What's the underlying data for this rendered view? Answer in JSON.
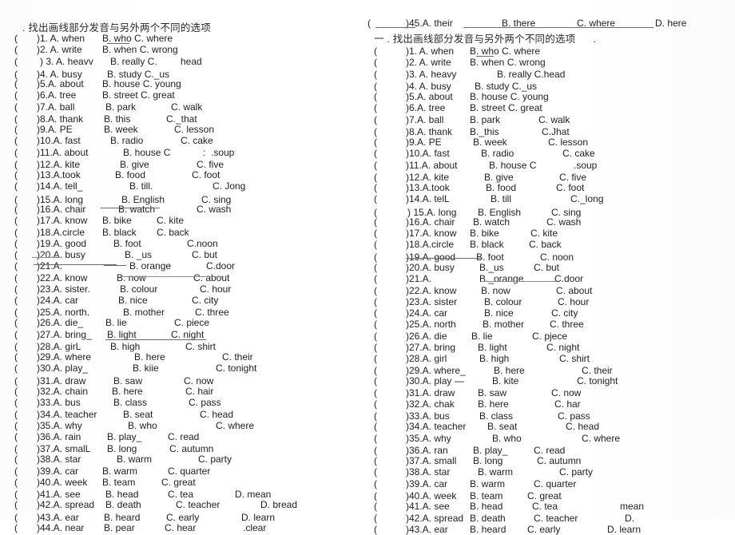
{
  "document": {
    "type": "scanned-worksheet",
    "background_color": "#ffffff",
    "text_color": "#1e1e1e",
    "rule_color": "#6b6b6b"
  },
  "left_column": {
    "heading": ". 找出画线部分发音与另外两个不同的选项",
    "bracket_open": "(",
    "rows": [
      {
        "num": ")1. A. when",
        "b": "B. who C. where"
      },
      {
        "num": ")2. A. write",
        "b": "B. when C. wrong"
      },
      {
        "num": ") 3. A. heavv",
        "b": "B. really C.",
        "c": "head"
      },
      {
        "num": ")4. A. busy",
        "b": "B. study C._us"
      },
      {
        "num": ")5.A. about",
        "b": "B. house C. young"
      },
      {
        "num": ")6.A. tree",
        "b": "B. street C. great"
      },
      {
        "num": ")7.A. ball",
        "b": "B. park",
        "c": "C. walk"
      },
      {
        "num": ")8.A. thank",
        "b": "B. this",
        "c": "C._that"
      },
      {
        "num": ")9.A. PE",
        "b": "B. week",
        "c": "C. lesson"
      },
      {
        "num": ")10.A. fast",
        "b": "B. radio",
        "c": "C. cake"
      },
      {
        "num": ")11.A. about",
        "b": "B. house C",
        "c": ":  .soup"
      },
      {
        "num": ")12.A. kite",
        "b": "B. give",
        "c": "C. five"
      },
      {
        "num": ")13.A.took",
        "b": "B. food",
        "c": "C. foot"
      },
      {
        "num": ")14.A. tell_",
        "b": "B. till.",
        "c": "C. Jong"
      },
      {
        "num": ")15.A. long",
        "b": "B. English",
        "c": "C. sing"
      },
      {
        "num": ")16.A. chair",
        "b": "B. watch",
        "c": "C. wash"
      },
      {
        "num": ")17.A. know",
        "b": "B. bike",
        "c": "C. kite"
      },
      {
        "num": ")18.A.circle",
        "b": "B. black",
        "c": "C. back"
      },
      {
        "num": ")19.A. good",
        "b": "B. foot",
        "c": "C.noon"
      },
      {
        "num": ")20.A. busy",
        "b": "B. _us",
        "c": "C. but"
      },
      {
        "num": ")21.A.",
        "b": "B. orange",
        "c": "C.door"
      },
      {
        "num": ")22.A. know",
        "b": "B. now",
        "c": "C. about"
      },
      {
        "num": ")23.A. sister.",
        "b": "B. colour",
        "c": "C. hour"
      },
      {
        "num": ")24.A. car",
        "b": "B. nice",
        "c": "C. city"
      },
      {
        "num": ")25.A. north.",
        "b": "B. mother",
        "c": "C. three"
      },
      {
        "num": ")26.A. die_",
        "b": "B. lie",
        "c": "C. piece"
      },
      {
        "num": ")27.A. bring_",
        "b": "B. light",
        "c": "C. night"
      },
      {
        "num": ")28.A. girL",
        "b": "B. high",
        "c": "C. shirt"
      },
      {
        "num": ")29.A. where",
        "b": "B. here",
        "c": "C. their"
      },
      {
        "num": ")30.A. play_",
        "b": "B. kiie",
        "c": "C. tonight"
      },
      {
        "num": ")31.A. draw",
        "b": "B. saw",
        "c": "C. now"
      },
      {
        "num": ")32.A. chain",
        "b": "B. here",
        "c": "C. hair"
      },
      {
        "num": ")33.A. bus",
        "b": "B. class",
        "c": "C. pass"
      },
      {
        "num": ")34.A. teacher",
        "b": "B. seat",
        "c": "C. head"
      },
      {
        "num": ")35.A. why",
        "b": "B. who",
        "c": "C. where"
      },
      {
        "num": ")36.A. rain",
        "b": "B. play_",
        "c": "C. read"
      },
      {
        "num": ")37.A. smalL",
        "b": "B. long",
        "c": "C. autumn"
      },
      {
        "num": ")38.A. star",
        "b": "B. warm",
        "c": "C. party"
      },
      {
        "num": ")39.A. car",
        "b": "B. warm",
        "c": "C. quarter"
      },
      {
        "num": ")40.A. week",
        "b": "B. team",
        "c": "C. great"
      },
      {
        "num": ")41.A. see",
        "b": "B. head",
        "c": "C. tea",
        "d": "D. mean"
      },
      {
        "num": ")42.A. spread",
        "b": "B. death",
        "c": "C. teacher",
        "d": "D. bread"
      },
      {
        "num": ")43.A. ear",
        "b": "B. heard",
        "c": "C. early",
        "d": "D. learn"
      },
      {
        "num": ")44.A. near",
        "b": "B. pear",
        "c": "C. hear",
        "d": ".clear"
      }
    ]
  },
  "right_column": {
    "top_row": {
      "num": ")45.A. their",
      "b": "B. there",
      "c": "C. where",
      "d": "D. here"
    },
    "heading": "一 . 找出画线部分发音与另外两个不同的选项      .",
    "bracket_open": "(",
    "rows": [
      {
        "num": ")1. A. when",
        "b": "B. who C. where"
      },
      {
        "num": ")2. A. write",
        "b": "B. when C. wrong"
      },
      {
        "num": ")3. A. heavy",
        "b": "B. really C.head"
      },
      {
        "num": ")4. A. busy",
        "b": "B. study C._us"
      },
      {
        "num": ")5.A. about",
        "b": "B. house C. young"
      },
      {
        "num": ")6.A. tree",
        "b": "B. street C. great"
      },
      {
        "num": ")7.A. ball",
        "b": "B. park",
        "c": "C. walk"
      },
      {
        "num": ")8.A. thank",
        "b": "B._this",
        "c": "C.Jhat"
      },
      {
        "num": ")9.A. PE",
        "b": "B. week",
        "c": "C. lesson"
      },
      {
        "num": ")10.A. fast",
        "b": "B. radio",
        "c": "C. cake"
      },
      {
        "num": ")11.A. about",
        "b": "B. house C",
        "c": ".soup"
      },
      {
        "num": ")12.A. kite",
        "b": "B. give",
        "c": "C. five"
      },
      {
        "num": ")13.A.took",
        "b": "B. food",
        "c": "C. foot"
      },
      {
        "num": ")14.A. telL",
        "b": "B. till",
        "c": "C._long"
      },
      {
        "num": ") 15.A. long",
        "b": "B. English",
        "c": "C. sing"
      },
      {
        "num": ")16.A. chair",
        "b": "B. watch",
        "c": "C. wash"
      },
      {
        "num": ")17.A. know",
        "b": "B. bike",
        "c": "C. kite"
      },
      {
        "num": ")18.A.circle",
        "b": "B. black",
        "c": "C. back"
      },
      {
        "num": ")19.A. good",
        "b": "B. foot",
        "c": "C. noon"
      },
      {
        "num": ")20.A. busy",
        "b": "B._us",
        "c": "C. but"
      },
      {
        "num": ")21.A.",
        "b": "B._orange",
        "c": "C.door"
      },
      {
        "num": ")22.A. know",
        "b": "B. now",
        "c": "C. about"
      },
      {
        "num": ")23.A. sister",
        "b": "B. colour",
        "c": "C. hour"
      },
      {
        "num": ")24.A. car",
        "b": "B. nice",
        "c": "C. city"
      },
      {
        "num": ")25.A. north",
        "b": "B. mother",
        "c": "C. three"
      },
      {
        "num": ")26.A. die",
        "b": "B. lie",
        "c": "C. pjece"
      },
      {
        "num": ")27.A. bring",
        "b": "B. light",
        "c": "C. night"
      },
      {
        "num": ")28.A. girl",
        "b": "B. high",
        "c": "C. shirt"
      },
      {
        "num": ")29.A. where_",
        "b": "B. here",
        "c": "C. their"
      },
      {
        "num": ")30.A. play —",
        "b": "B. kite",
        "c": "C. tonight"
      },
      {
        "num": ")31.A. draw",
        "b": "B. saw",
        "c": "C. now"
      },
      {
        "num": ")32.A. chak",
        "b": "B. here",
        "c": "C. har"
      },
      {
        "num": ")33.A. bus",
        "b": "B. class",
        "c": "C. pass"
      },
      {
        "num": ")34.A. teacher",
        "b": "B. seat",
        "c": "C. head"
      },
      {
        "num": ")35.A. why",
        "b": "B. who",
        "c": "C. where"
      },
      {
        "num": ")36.A. ran",
        "b": "B. play_",
        "c": "C. read"
      },
      {
        "num": ")37.A. small",
        "b": "B. long",
        "c": "C. autumn"
      },
      {
        "num": ")38.A. star",
        "b": "B. warm",
        "c": "C. party"
      },
      {
        "num": ")39.A. car",
        "b": "B. warm",
        "c": "C. quarter"
      },
      {
        "num": ")40.A. week",
        "b": "B. team",
        "c": "C. great"
      },
      {
        "num": ")41.A. see",
        "b": "B. head",
        "c": "C. tea",
        "d": "mean"
      },
      {
        "num": ")42.A. spread",
        "b": "B. death",
        "c": "C. teacher",
        "d": "D."
      },
      {
        "num": ")43.A. ear",
        "b": "B. heard",
        "c": "C. early",
        "d": "D. learn"
      }
    ]
  }
}
